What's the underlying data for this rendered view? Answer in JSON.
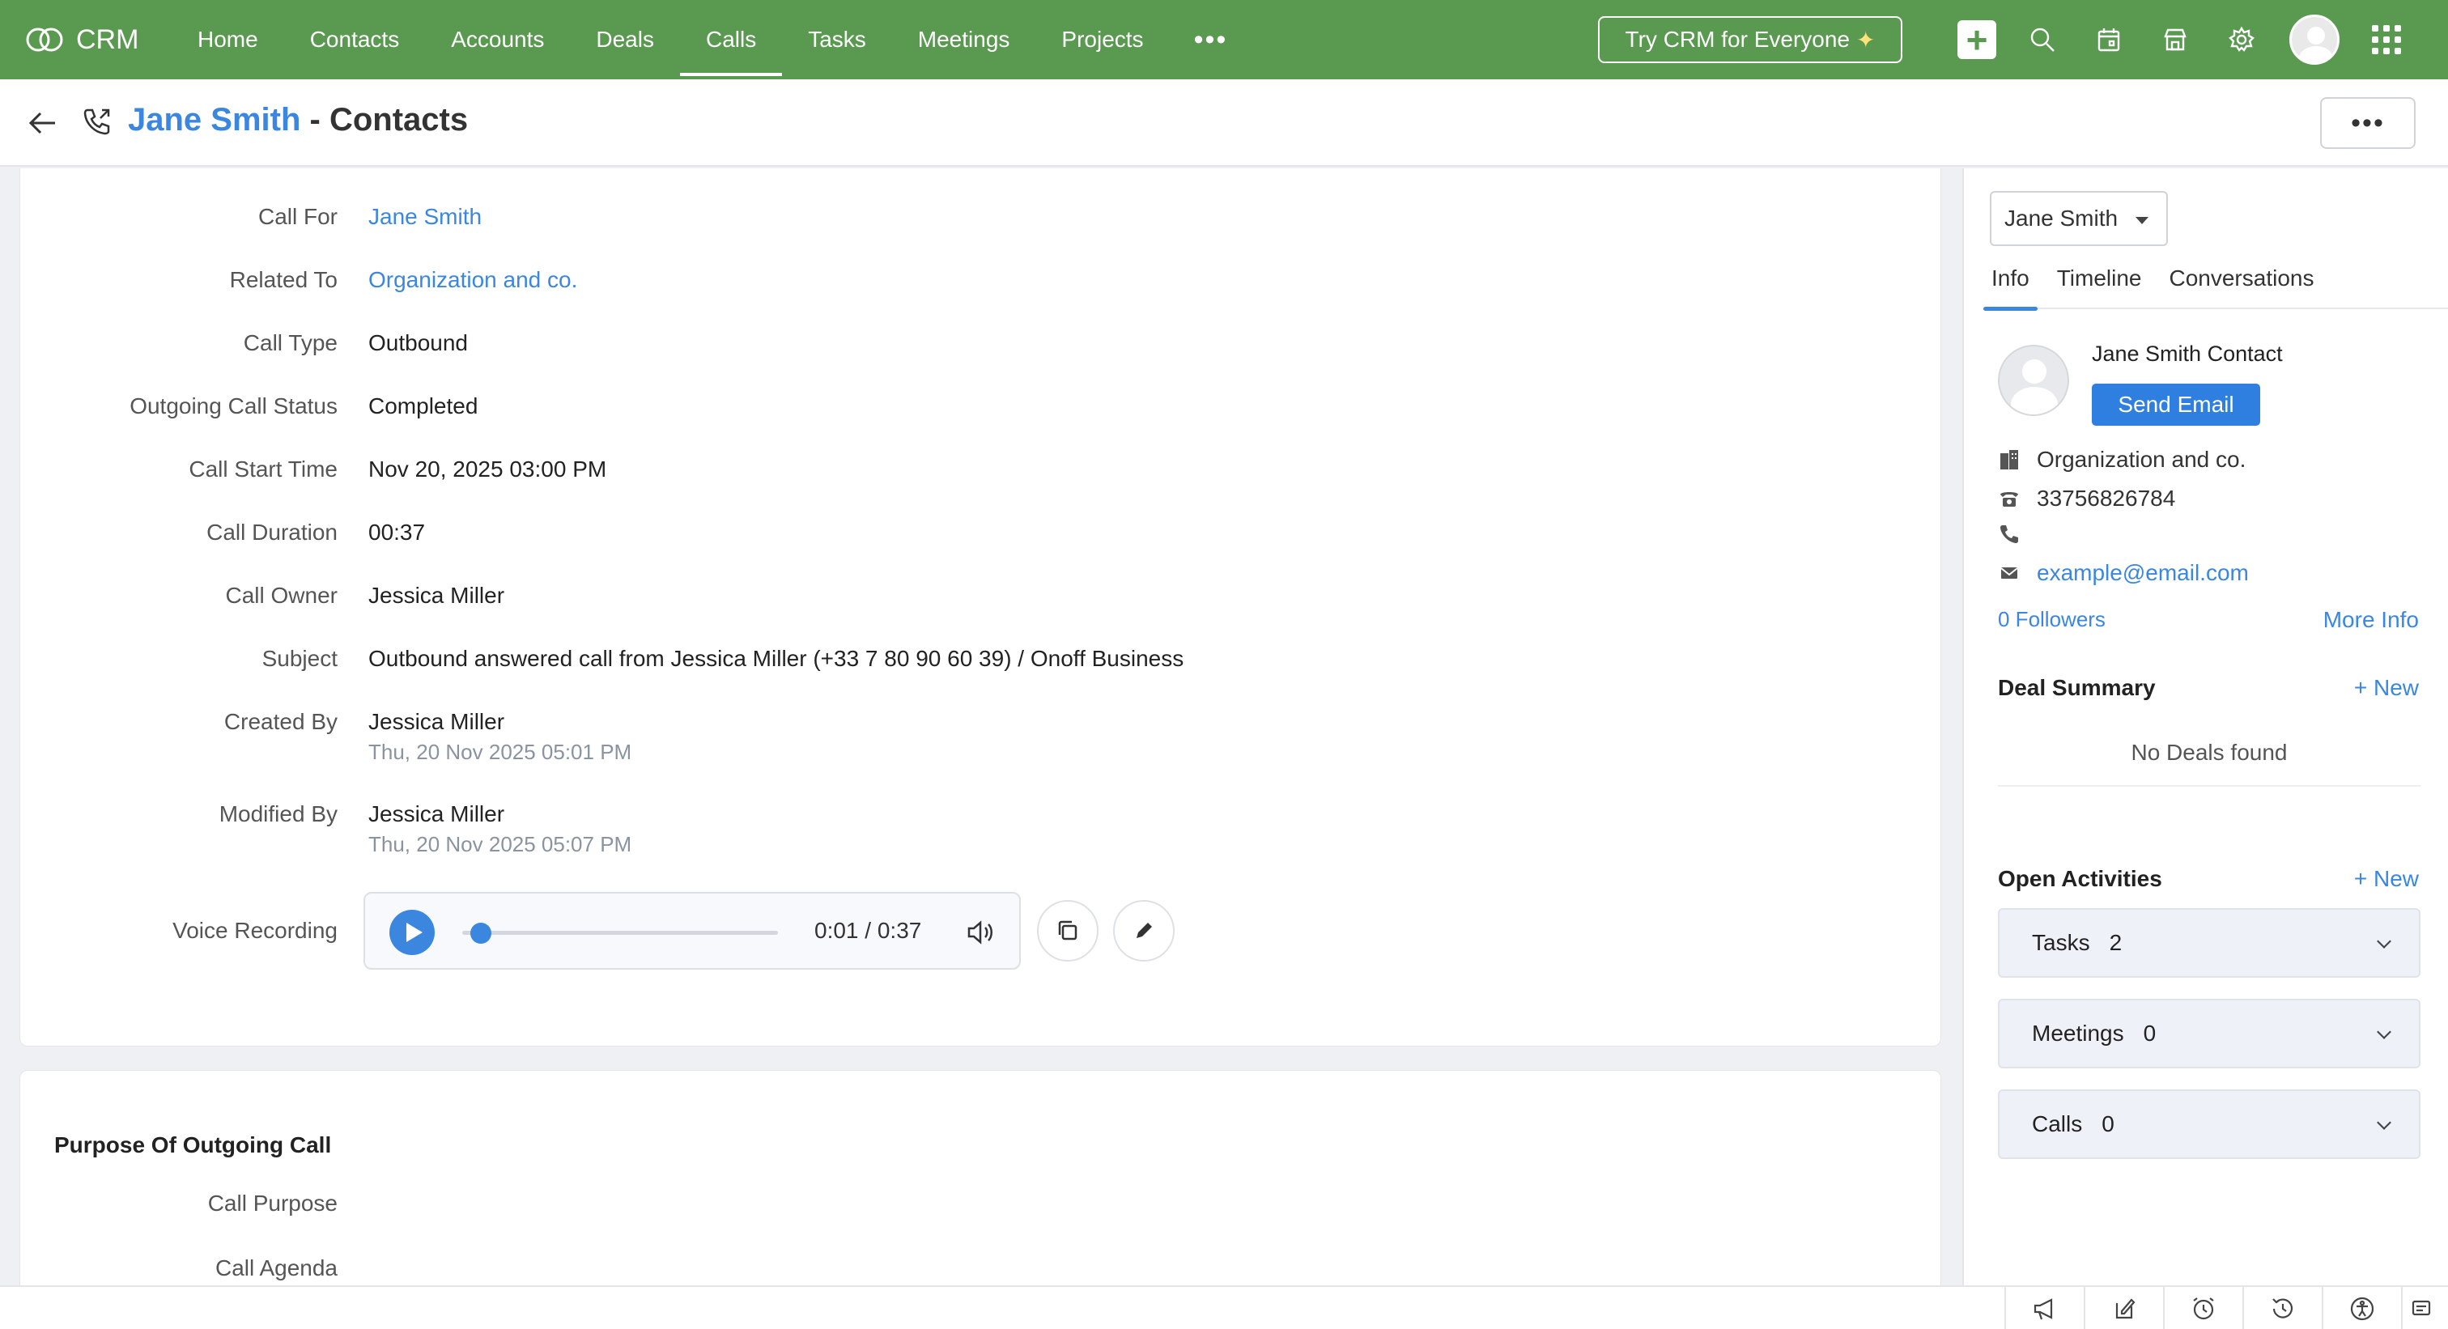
{
  "app": {
    "name": "CRM"
  },
  "nav": {
    "items": [
      "Home",
      "Contacts",
      "Accounts",
      "Deals",
      "Calls",
      "Tasks",
      "Meetings",
      "Projects"
    ],
    "active_index": 4,
    "more": "•••"
  },
  "top_actions": {
    "try_label": "Try CRM for Everyone",
    "try_glyph": "✦"
  },
  "header": {
    "contact_name": "Jane Smith",
    "title_suffix": " - Contacts",
    "more": "•••"
  },
  "details": {
    "call_for": {
      "label": "Call For",
      "value": "Jane Smith"
    },
    "related_to": {
      "label": "Related To",
      "value": "Organization and co."
    },
    "call_type": {
      "label": "Call Type",
      "value": "Outbound"
    },
    "status": {
      "label": "Outgoing Call Status",
      "value": "Completed"
    },
    "start_time": {
      "label": "Call Start Time",
      "value": "Nov 20, 2025 03:00 PM"
    },
    "duration": {
      "label": "Call Duration",
      "value": "00:37"
    },
    "owner": {
      "label": "Call Owner",
      "value": "Jessica Miller"
    },
    "subject": {
      "label": "Subject",
      "value": "Outbound answered call from Jessica Miller (+33 7 80 90 60 39) / Onoff Business"
    },
    "created_by": {
      "label": "Created By",
      "value": "Jessica Miller",
      "time": "Thu, 20 Nov 2025 05:01 PM"
    },
    "modified_by": {
      "label": "Modified By",
      "value": "Jessica Miller",
      "time": "Thu, 20 Nov 2025 05:07 PM"
    },
    "voice_recording": {
      "label": "Voice Recording",
      "current": "0:01",
      "separator": "/",
      "total": "0:37",
      "progress": 0.027
    }
  },
  "purpose": {
    "title": "Purpose Of Outgoing Call",
    "call_purpose_label": "Call Purpose",
    "call_agenda_label": "Call Agenda"
  },
  "right_panel": {
    "selector": "Jane Smith",
    "tabs": [
      "Info",
      "Timeline",
      "Conversations"
    ],
    "active_tab": 0,
    "contact_line": "Jane Smith Contact",
    "send_email": "Send Email",
    "account": "Organization and co.",
    "phone": "33756826784",
    "mobile": "",
    "email": "example@email.com",
    "followers": "0 Followers",
    "more_info": "More Info",
    "deal_summary": {
      "title": "Deal Summary",
      "new": "+ New",
      "empty": "No Deals found"
    },
    "open_activities": {
      "title": "Open Activities",
      "new": "+ New",
      "items": [
        {
          "label": "Tasks",
          "count": "2"
        },
        {
          "label": "Meetings",
          "count": "0"
        },
        {
          "label": "Calls",
          "count": "0"
        }
      ]
    }
  },
  "colors": {
    "nav_green": "#5a9a50",
    "link_blue": "#3b87e0",
    "button_blue": "#2f7fe0"
  }
}
